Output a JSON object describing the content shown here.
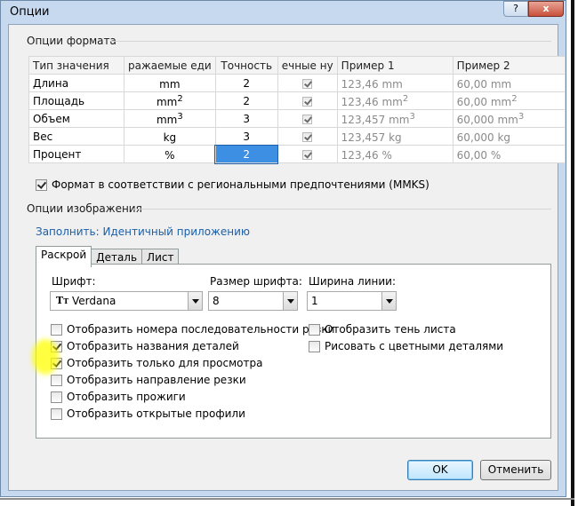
{
  "window": {
    "title": "Опции",
    "help_label": "?",
    "close_label": "x"
  },
  "format_section": {
    "title": "Опции формата",
    "columns": [
      "Тип значения",
      "ражаемые еди",
      "Точность",
      "ечные ну",
      "Пример 1",
      "Пример 2"
    ],
    "rows": [
      {
        "type": "Длина",
        "unit": "mm",
        "unit_sup": "",
        "precision": "2",
        "zeros": true,
        "ex1": "123,46 mm",
        "ex1_sup": "",
        "ex2": "60,00 mm",
        "ex2_sup": ""
      },
      {
        "type": "Площадь",
        "unit": "mm",
        "unit_sup": "2",
        "precision": "2",
        "zeros": true,
        "ex1": "123,46 mm",
        "ex1_sup": "2",
        "ex2": "60,00 mm",
        "ex2_sup": "2"
      },
      {
        "type": "Объем",
        "unit": "mm",
        "unit_sup": "3",
        "precision": "3",
        "zeros": true,
        "ex1": "123,457 mm",
        "ex1_sup": "3",
        "ex2": "60,000 mm",
        "ex2_sup": "3"
      },
      {
        "type": "Вес",
        "unit": "kg",
        "unit_sup": "",
        "precision": "3",
        "zeros": true,
        "ex1": "123,457 kg",
        "ex1_sup": "",
        "ex2": "60,000 kg",
        "ex2_sup": ""
      },
      {
        "type": "Процент",
        "unit": "%",
        "unit_sup": "",
        "precision": "2",
        "zeros": true,
        "ex1": "123,46 %",
        "ex1_sup": "",
        "ex2": "60,00 %",
        "ex2_sup": ""
      }
    ],
    "regional_checkbox": {
      "label": "Формат в соответствии с региональными предпочтениями (MMKS)",
      "checked": true
    }
  },
  "image_section": {
    "title": "Опции изображения",
    "fill_link": "Заполнить: Идентичный приложению",
    "tabs": [
      "Раскрой",
      "Деталь",
      "Лист"
    ],
    "active_tab": "Раскрой",
    "font_label": "Шрифт:",
    "font_value": "Verdana",
    "font_icon": "font-icon",
    "font_size_label": "Размер шрифта:",
    "font_size_value": "8",
    "line_width_label": "Ширина линии:",
    "line_width_value": "1",
    "left_checks": [
      {
        "label": "Отобразить номера последовательности резки",
        "checked": false
      },
      {
        "label": "Отобразить названия деталей",
        "checked": true
      },
      {
        "label": "Отобразить только для просмотра",
        "checked": true
      },
      {
        "label": "Отобразить направление резки",
        "checked": false
      },
      {
        "label": "Отобразить прожиги",
        "checked": false
      },
      {
        "label": "Отобразить открытые профили",
        "checked": false
      }
    ],
    "right_checks": [
      {
        "label": "Отобразить тень листа",
        "checked": false
      },
      {
        "label": "Рисовать с цветными деталями",
        "checked": false
      }
    ]
  },
  "buttons": {
    "ok": "OK",
    "cancel": "Отменить"
  },
  "colors": {
    "selection": "#3c8fe3",
    "link": "#1b5fa8",
    "highlight": "#ffff00"
  }
}
